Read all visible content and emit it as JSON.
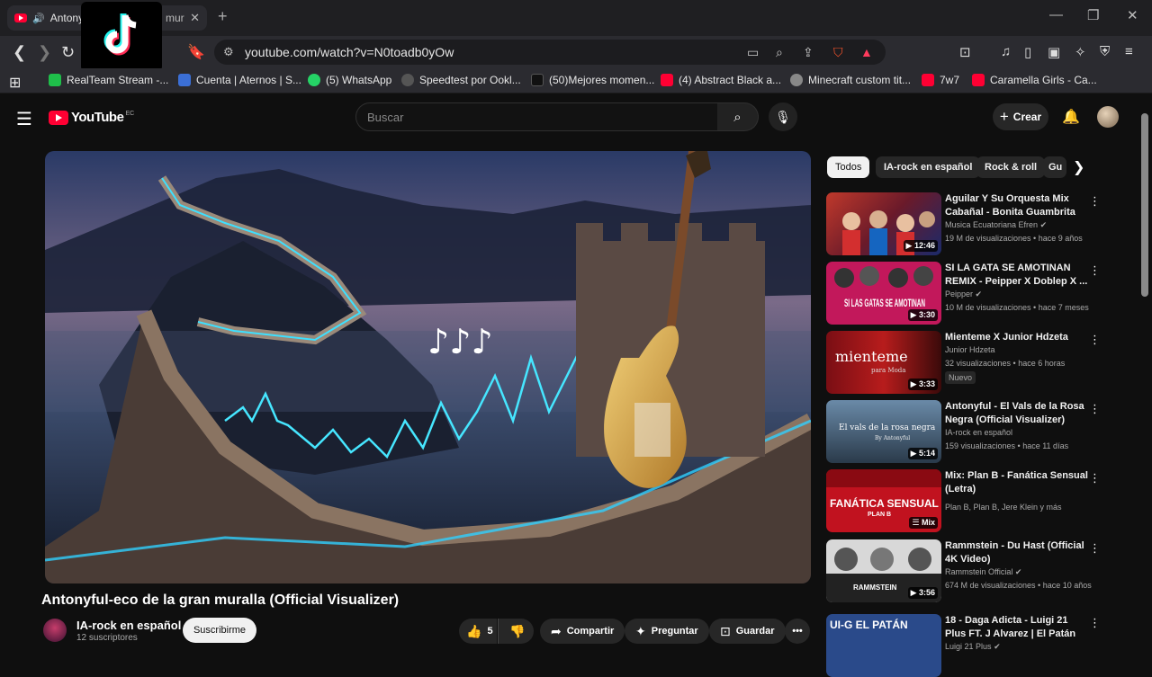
{
  "browser": {
    "tab_title": "Antonyf",
    "tab_title_tail": "mur",
    "url": "youtube.com/watch?v=N0toadb0yOw",
    "bookmarks": [
      {
        "label": "RealTeam Stream -...",
        "color": "#1fbf4a"
      },
      {
        "label": "Cuenta | Aternos | S...",
        "color": "#3b6fd6"
      },
      {
        "label": "(5) WhatsApp",
        "color": "#25d366"
      },
      {
        "label": "Speedtest por Ookl...",
        "color": "#555555"
      },
      {
        "label": "(50)Mejores momen...",
        "color": "#111111"
      },
      {
        "label": "(4) Abstract Black a...",
        "color": "#ff0033"
      },
      {
        "label": "Minecraft custom tit...",
        "color": "#888888"
      },
      {
        "label": "7w7",
        "color": "#ff0033"
      },
      {
        "label": "Caramella Girls - Ca...",
        "color": "#ff0033"
      }
    ]
  },
  "youtube": {
    "logo_text": "YouTube",
    "logo_country": "EC",
    "search_placeholder": "Buscar",
    "create_label": "Crear"
  },
  "video": {
    "title": "Antonyful-eco de la gran muralla (Official Visualizer)",
    "notes": "♪♪♪",
    "channel": "IA-rock en español",
    "subscribers": "12 suscriptores",
    "subscribe_label": "Suscribirme",
    "likes": "5",
    "share_label": "Compartir",
    "ask_label": "Preguntar",
    "save_label": "Guardar"
  },
  "chips": [
    "Todos",
    "IA-rock en español",
    "Rock & roll",
    "Gu"
  ],
  "recommendations": [
    {
      "title": "Aguilar Y Su Orquesta Mix Cabañal - Bonita Guambrita",
      "channel": "Musica Ecuatoriana Efren",
      "meta": "19 M de visualizaciones • hace 9 años",
      "duration": "12:46",
      "verified": true,
      "badge": ""
    },
    {
      "title": "SI LA GATA SE AMOTINAN REMIX - Peipper X Doblep X ...",
      "channel": "Peipper",
      "meta": "10 M de visualizaciones • hace 7 meses",
      "duration": "3:30",
      "verified": true,
      "badge": ""
    },
    {
      "title": "Mienteme X Junior Hdzeta",
      "channel": "Junior Hdzeta",
      "meta": "32 visualizaciones • hace 6 horas",
      "duration": "3:33",
      "verified": false,
      "badge": "Nuevo"
    },
    {
      "title": "Antonyful - El Vals de la Rosa Negra (Official Visualizer)",
      "channel": "IA-rock en español",
      "meta": "159 visualizaciones • hace 11 días",
      "duration": "5:14",
      "verified": false,
      "badge": ""
    },
    {
      "title": "Mix: Plan B - Fanática Sensual (Letra)",
      "channel": "Plan B, Plan B, Jere Klein y más",
      "meta": "",
      "duration": "Mix",
      "verified": false,
      "badge": ""
    },
    {
      "title": "Rammstein - Du Hast (Official 4K Video)",
      "channel": "Rammstein Official",
      "meta": "674 M de visualizaciones • hace 10 años",
      "duration": "3:56",
      "verified": true,
      "badge": ""
    },
    {
      "title": "18 - Daga Adicta - Luigi 21 Plus FT. J Alvarez | El Patán",
      "channel": "Luigi 21 Plus",
      "meta": "",
      "duration": "",
      "verified": true,
      "badge": ""
    }
  ],
  "thumb_texts": {
    "gata": "SI LAS GATAS SE AMOTINAN",
    "mienteme": "mienteme",
    "mienteme_sub": "para Moda",
    "vals": "El vals de la rosa negra",
    "vals_sub": "By Antonyful",
    "fanatica": "FANÁTICA SENSUAL",
    "fanatica_sub": "PLAN B",
    "rammstein": "RAMMSTEIN",
    "daga": "UI-G EL PATÁN"
  }
}
